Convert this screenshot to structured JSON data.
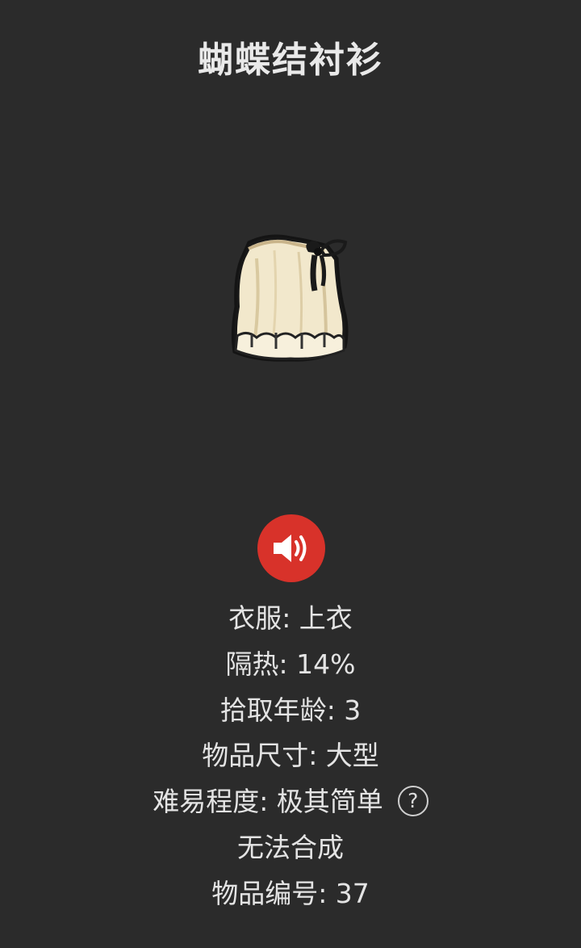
{
  "item": {
    "title": "蝴蝶结衬衫",
    "image_icon": "bow-shirt-icon"
  },
  "sound": {
    "icon": "speaker-icon",
    "color": "#d8322a"
  },
  "info": {
    "clothing": "衣服: 上衣",
    "insulation": "隔热: 14%",
    "pickup_age": "拾取年龄: 3",
    "item_size": "物品尺寸: 大型",
    "difficulty": "难易程度: 极其简单",
    "help_symbol": "?",
    "craft": "无法合成",
    "item_id": "物品编号: 37"
  }
}
